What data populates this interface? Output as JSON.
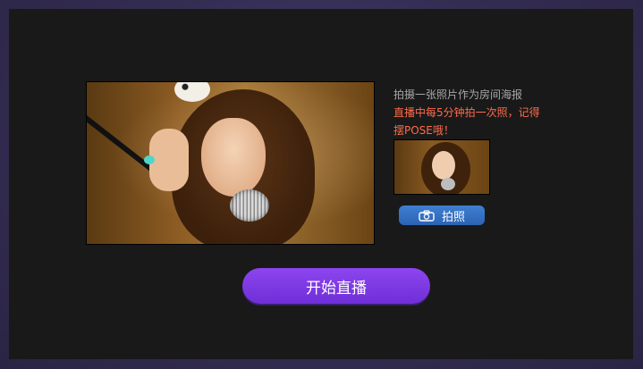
{
  "hint": {
    "line1": "拍摄一张照片作为房间海报",
    "line2": "直播中每5分钟拍一次照，记得",
    "line3": "摆POSE哦！"
  },
  "photo_button": {
    "label": "拍照",
    "icon": "camera-icon",
    "color": "#3a74c8"
  },
  "start_button": {
    "label": "开始直播",
    "color": "#7d3ae6"
  },
  "colors": {
    "panel_bg": "#191919",
    "hint_gray": "#a8a8a8",
    "hint_accent": "#ff6b4a"
  }
}
